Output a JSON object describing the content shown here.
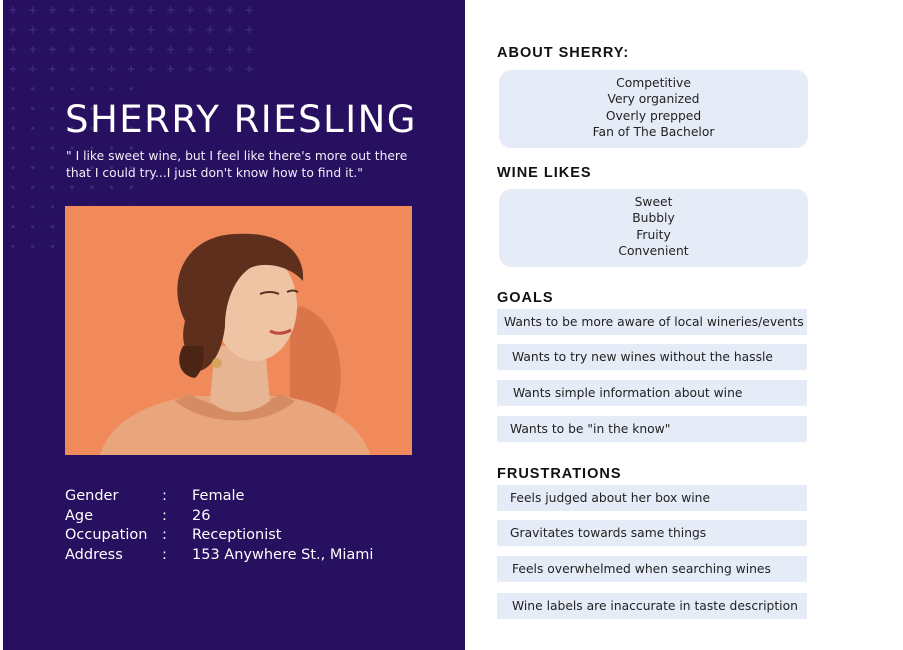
{
  "persona": {
    "name": "SHERRY RIESLING",
    "quote": "\" I like sweet wine, but I feel like there's more out there that I could try...I just don't know how to find it.\"",
    "photo_alt": "portrait photo",
    "details": [
      {
        "label": "Gender",
        "value": "Female"
      },
      {
        "label": "Age",
        "value": "26"
      },
      {
        "label": "Occupation",
        "value": "Receptionist"
      },
      {
        "label": "Address",
        "value": "153 Anywhere St., Miami"
      }
    ],
    "colon": ":"
  },
  "about": {
    "heading": "ABOUT SHERRY:",
    "items": [
      "Competitive",
      "Very organized",
      "Overly prepped",
      "Fan of The Bachelor"
    ]
  },
  "likes": {
    "heading": "WINE LIKES",
    "items": [
      "Sweet",
      "Bubbly",
      "Fruity",
      "Convenient"
    ]
  },
  "goals": {
    "heading": "GOALS",
    "items": [
      "Wants to be more aware of local wineries/events",
      "Wants to try new wines without the hassle",
      "Wants simple information about wine",
      "Wants to be \"in the know\""
    ]
  },
  "frustrations": {
    "heading": "FRUSTRATIONS",
    "items": [
      "Feels judged about her box wine",
      "Gravitates towards same things",
      "Feels overwhelmed when searching wines",
      "Wine labels are inaccurate in taste description"
    ]
  },
  "colors": {
    "panel": "#26105f",
    "photo_background": "#f08a5a",
    "box": "#e6ecf7",
    "heading_text": "#111111"
  }
}
